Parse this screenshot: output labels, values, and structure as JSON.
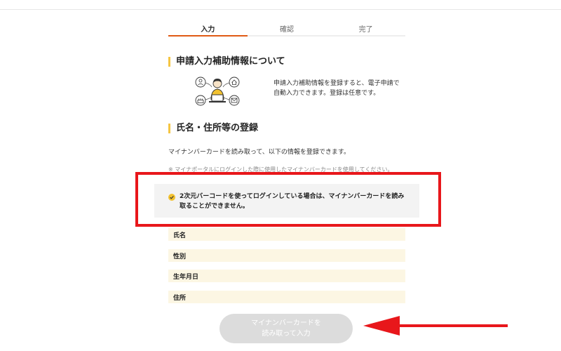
{
  "stepper": {
    "steps": [
      {
        "label": "入力",
        "active": true
      },
      {
        "label": "確認",
        "active": false
      },
      {
        "label": "完了",
        "active": false
      }
    ],
    "active_color": "#e05a14"
  },
  "section1": {
    "title": "申請入力補助情報について",
    "intro_line1": "申請入力補助情報を登録すると、電子申請で",
    "intro_line2": "自動入力できます。登録は任意です。"
  },
  "section2": {
    "title": "氏名・住所等の登録",
    "description": "マイナンバーカードを読み取って、以下の情報を登録できます。",
    "note": "※ マイナポータルにログインした際に使用したマイナンバーカードを使用してください。"
  },
  "notice": {
    "line1": "2次元バーコードを使ってログインしている場合は、マイナンバーカードを読み",
    "line2": "取ることができません。"
  },
  "fields": [
    {
      "label": "氏名"
    },
    {
      "label": "性別"
    },
    {
      "label": "生年月日"
    },
    {
      "label": "住所"
    }
  ],
  "button": {
    "line1": "マイナンバーカードを",
    "line2": "読み取って入力"
  },
  "colors": {
    "heading_accent": "#f5c542",
    "highlight_box": "#e8171b",
    "field_bg": "#fcf6e3",
    "button_disabled": "#dcdcdc"
  },
  "icons": [
    "person-at-laptop-illustration",
    "person-icon",
    "home-icon",
    "cake-icon",
    "mail-icon",
    "check-icon",
    "arrow-left-annotation"
  ]
}
